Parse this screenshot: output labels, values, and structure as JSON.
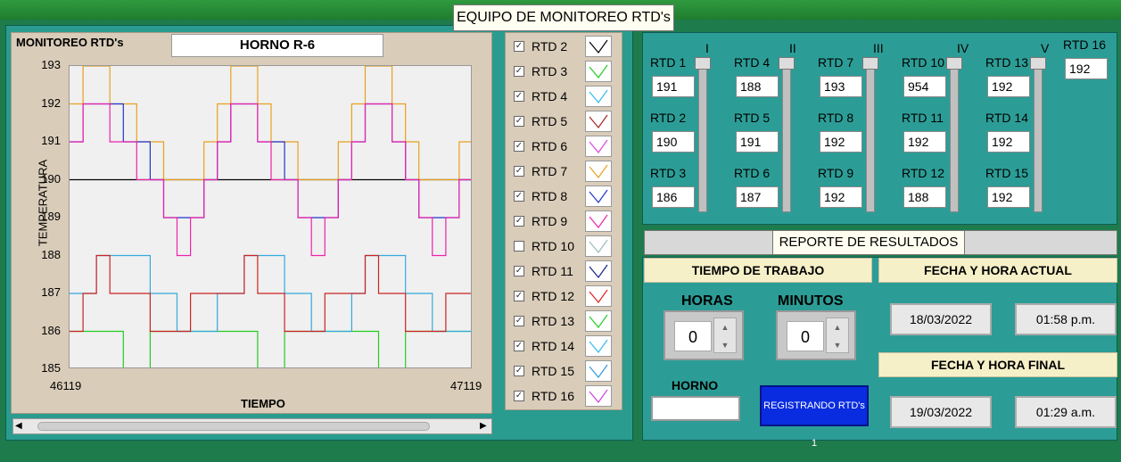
{
  "window": {
    "title": "EQUIPO DE MONITOREO RTD's"
  },
  "chart_panel": {
    "label": "MONITOREO RTD's",
    "oven_name": "HORNO R-6"
  },
  "chart_data": {
    "type": "line",
    "xlabel": "TIEMPO",
    "ylabel": "TEMPERATURA",
    "xlim": [
      46119,
      47119
    ],
    "ylim": [
      185,
      193
    ],
    "x_ticks": [
      "46119",
      "47119"
    ],
    "y_ticks": [
      "193",
      "192",
      "191",
      "190",
      "189",
      "188",
      "187",
      "186",
      "185"
    ],
    "series": [
      {
        "name": "RTD 2",
        "color": "#000000",
        "pattern": [
          190,
          190,
          190,
          190,
          190,
          190,
          190,
          190,
          190,
          190,
          190,
          190,
          190,
          190,
          190,
          190,
          190,
          190,
          190,
          190,
          190,
          190,
          190,
          190,
          190,
          190,
          190,
          190,
          190,
          190
        ]
      },
      {
        "name": "RTD 3",
        "color": "#22cc22",
        "pattern": [
          186,
          186,
          186,
          186,
          185,
          185,
          186,
          186,
          186,
          186,
          186,
          186,
          186,
          186,
          185,
          185,
          186,
          186,
          186,
          186,
          186,
          186,
          186,
          185,
          185,
          186,
          186,
          186,
          186,
          186
        ]
      },
      {
        "name": "RTD 4",
        "color": "#33aadd",
        "pattern": [
          187,
          187,
          188,
          188,
          188,
          188,
          187,
          187,
          186,
          186,
          186,
          187,
          187,
          188,
          188,
          188,
          187,
          187,
          186,
          186,
          186,
          187,
          188,
          188,
          188,
          187,
          187,
          186,
          186,
          186
        ]
      },
      {
        "name": "RTD 5",
        "color": "#cc2222",
        "pattern": [
          186,
          187,
          188,
          187,
          187,
          187,
          186,
          186,
          186,
          187,
          187,
          187,
          187,
          188,
          187,
          187,
          186,
          186,
          186,
          187,
          187,
          187,
          188,
          187,
          187,
          186,
          186,
          186,
          187,
          187
        ]
      },
      {
        "name": "RTD 7",
        "color": "#e8a020",
        "pattern": [
          192,
          193,
          193,
          192,
          192,
          191,
          191,
          190,
          190,
          190,
          191,
          192,
          193,
          193,
          192,
          191,
          191,
          190,
          190,
          190,
          191,
          192,
          193,
          193,
          192,
          191,
          190,
          190,
          190,
          191
        ]
      },
      {
        "name": "RTD 8",
        "color": "#2233cc",
        "pattern": [
          191,
          192,
          192,
          192,
          191,
          191,
          190,
          189,
          189,
          189,
          190,
          191,
          192,
          192,
          191,
          191,
          190,
          189,
          189,
          189,
          190,
          191,
          192,
          192,
          191,
          190,
          189,
          189,
          189,
          190
        ]
      },
      {
        "name": "RTD 9",
        "color": "#ee22aa",
        "pattern": [
          191,
          192,
          192,
          191,
          191,
          190,
          190,
          189,
          188,
          189,
          190,
          191,
          192,
          192,
          191,
          190,
          190,
          189,
          188,
          189,
          190,
          191,
          192,
          192,
          191,
          190,
          189,
          188,
          189,
          190
        ]
      }
    ]
  },
  "legend": [
    {
      "label": "RTD 2",
      "checked": true,
      "color": "#000000"
    },
    {
      "label": "RTD 3",
      "checked": true,
      "color": "#22cc22"
    },
    {
      "label": "RTD 4",
      "checked": true,
      "color": "#33bbee"
    },
    {
      "label": "RTD 5",
      "checked": true,
      "color": "#aa2222"
    },
    {
      "label": "RTD 6",
      "checked": true,
      "color": "#dd44dd"
    },
    {
      "label": "RTD 7",
      "checked": true,
      "color": "#e8a020"
    },
    {
      "label": "RTD 8",
      "checked": true,
      "color": "#2233cc"
    },
    {
      "label": "RTD 9",
      "checked": true,
      "color": "#ee22aa"
    },
    {
      "label": "RTD 10",
      "checked": false,
      "color": "#99bbbb"
    },
    {
      "label": "RTD 11",
      "checked": true,
      "color": "#112288"
    },
    {
      "label": "RTD 12",
      "checked": true,
      "color": "#dd2222"
    },
    {
      "label": "RTD 13",
      "checked": true,
      "color": "#22cc22"
    },
    {
      "label": "RTD 14",
      "checked": true,
      "color": "#33bbee"
    },
    {
      "label": "RTD 15",
      "checked": true,
      "color": "#3399dd"
    },
    {
      "label": "RTD 16",
      "checked": true,
      "color": "#cc44dd"
    }
  ],
  "sliders": [
    "I",
    "II",
    "III",
    "IV",
    "V"
  ],
  "rtd_groups": [
    [
      {
        "label": "RTD 1",
        "value": "191"
      },
      {
        "label": "RTD 2",
        "value": "190"
      },
      {
        "label": "RTD 3",
        "value": "186"
      }
    ],
    [
      {
        "label": "RTD 4",
        "value": "188"
      },
      {
        "label": "RTD 5",
        "value": "191"
      },
      {
        "label": "RTD 6",
        "value": "187"
      }
    ],
    [
      {
        "label": "RTD 7",
        "value": "193"
      },
      {
        "label": "RTD 8",
        "value": "192"
      },
      {
        "label": "RTD 9",
        "value": "192"
      }
    ],
    [
      {
        "label": "RTD 10",
        "value": "954"
      },
      {
        "label": "RTD 11",
        "value": "192"
      },
      {
        "label": "RTD 12",
        "value": "188"
      }
    ],
    [
      {
        "label": "RTD 13",
        "value": "192"
      },
      {
        "label": "RTD 14",
        "value": "192"
      },
      {
        "label": "RTD 15",
        "value": "192"
      }
    ]
  ],
  "rtd16": {
    "label": "RTD 16",
    "value": "192"
  },
  "report": {
    "title": "REPORTE DE RESULTADOS",
    "work_time_header": "TIEMPO DE TRABAJO",
    "hours_label": "HORAS",
    "hours_value": "0",
    "minutes_label": "MINUTOS",
    "minutes_value": "0",
    "oven_label": "HORNO",
    "oven_value": "",
    "register_button": "REGISTRANDO RTD's 1",
    "current_header": "FECHA Y HORA ACTUAL",
    "current_date": "18/03/2022",
    "current_time": "01:58 p.m.",
    "final_header": "FECHA Y HORA FINAL",
    "final_date": "19/03/2022",
    "final_time": "01:29 a.m."
  }
}
